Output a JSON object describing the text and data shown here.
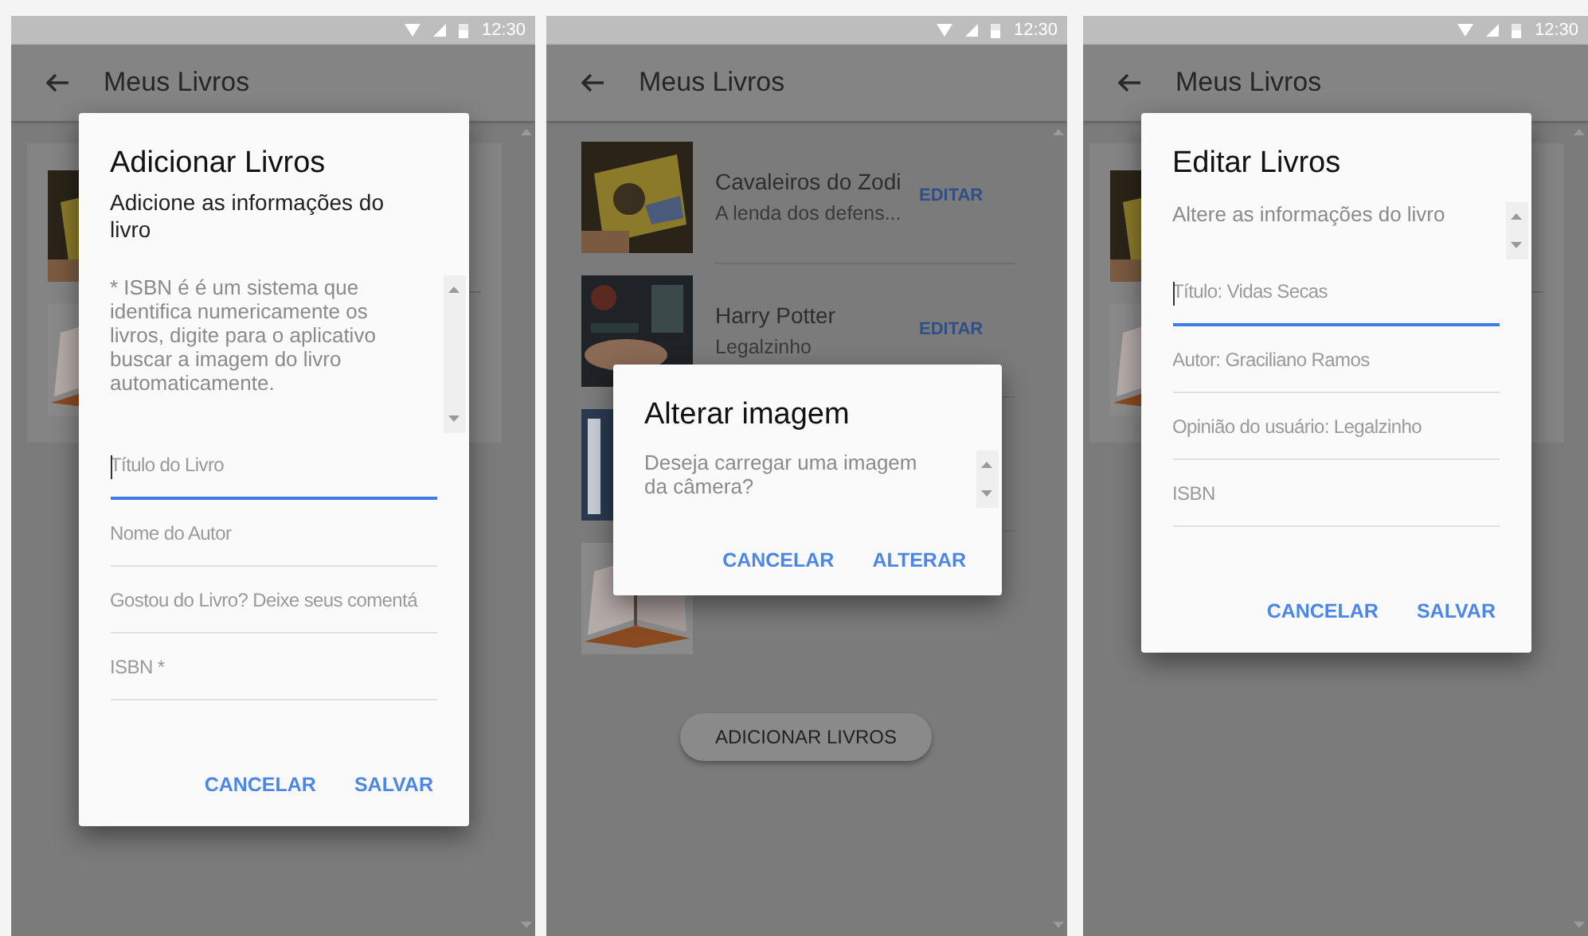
{
  "screens": [
    {
      "status_bar": {
        "time": "12:30"
      },
      "app_bar": {
        "title": "Meus Livros"
      },
      "books": [
        {
          "kind": "picture"
        },
        {
          "kind": "picture"
        }
      ],
      "dialog": {
        "kind": "form",
        "title": "Adicionar Livros",
        "subtitle": "Adicione as informações do livro",
        "scroll_text": "* ISBN é é um sistema que identifica numericamente os livros, digite para o aplicativo buscar a imagem do livro automaticamente.",
        "fields": [
          {
            "placeholder": "Título do Livro",
            "focused": true
          },
          {
            "placeholder": "Nome do Autor",
            "focused": false
          },
          {
            "placeholder": "Gostou do Livro? Deixe seus comentá",
            "focused": false
          },
          {
            "placeholder": "ISBN *",
            "focused": false
          }
        ],
        "actions": [
          "CANCELAR",
          "SALVAR"
        ]
      }
    },
    {
      "status_bar": {
        "time": "12:30"
      },
      "app_bar": {
        "title": "Meus Livros"
      },
      "books": [
        {
          "kind": "picture",
          "title": "Cavaleiros do Zodi",
          "subtitle": "A lenda dos defens...",
          "action": "EDITAR"
        },
        {
          "kind": "picture",
          "title": "Harry Potter",
          "subtitle": "Legalzinho",
          "action": "EDITAR"
        },
        {
          "kind": "picture"
        },
        {
          "kind": "picture"
        }
      ],
      "add_button": "ADICIONAR LIVROS",
      "dialog": {
        "kind": "confirm",
        "title": "Alterar imagem",
        "scroll_text": "Deseja carregar uma imagem da câmera?",
        "actions": [
          "CANCELAR",
          "ALTERAR"
        ]
      }
    },
    {
      "status_bar": {
        "time": "12:30"
      },
      "app_bar": {
        "title": "Meus Livros"
      },
      "books": [
        {
          "kind": "picture"
        },
        {
          "kind": "picture"
        }
      ],
      "dialog": {
        "kind": "form",
        "title": "Editar Livros",
        "scroll_text": "Altere as informações do livro",
        "fields": [
          {
            "placeholder": "Título: Vidas Secas",
            "focused": true
          },
          {
            "placeholder": "Autor: Graciliano Ramos",
            "focused": false
          },
          {
            "placeholder": "Opinião do usuário: Legalzinho",
            "focused": false
          },
          {
            "placeholder": "ISBN",
            "focused": false
          }
        ],
        "actions": [
          "CANCELAR",
          "SALVAR"
        ]
      }
    }
  ]
}
